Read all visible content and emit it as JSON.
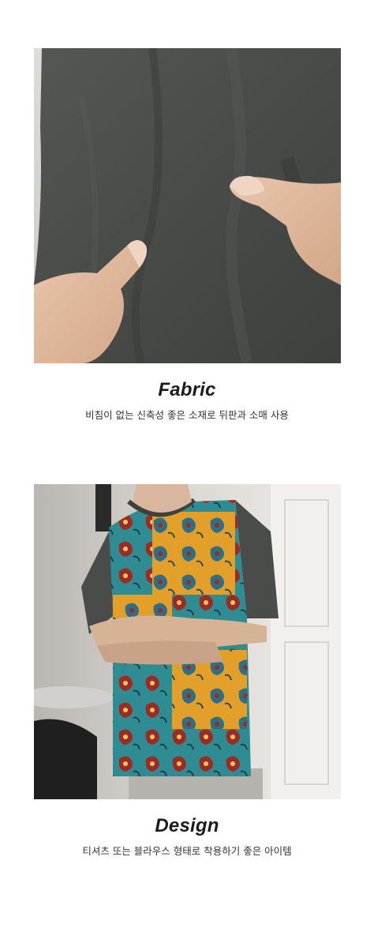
{
  "sections": [
    {
      "id": "fabric",
      "title": "Fabric",
      "description": "비침이 없는 신축성 좋은 소재로 뒤판과 소매 사용",
      "photo_subject": "dark-gray-knit-fabric-stretched-by-hands"
    },
    {
      "id": "design",
      "title": "Design",
      "description": "티셔츠 또는 블라우스 형태로 착용하기 좋은 아이템",
      "photo_subject": "model-wearing-paisley-scarf-print-tshirt"
    }
  ],
  "colors": {
    "fabric": "#4b4d4a",
    "pattern_teal": "#2f8c93",
    "pattern_mustard": "#e2a02a",
    "pattern_red": "#9c2a26",
    "text": "#1c1c1c"
  }
}
